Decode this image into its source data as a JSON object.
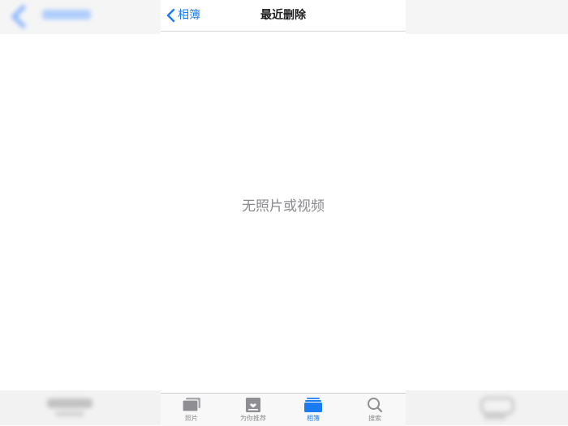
{
  "nav": {
    "back_label": "相簿",
    "title": "最近删除"
  },
  "main": {
    "empty_message": "无照片或视频"
  },
  "tabbar": {
    "tabs": [
      {
        "label": "照片",
        "icon": "photos-icon",
        "active": false
      },
      {
        "label": "为你推荐",
        "icon": "for-you-icon",
        "active": false
      },
      {
        "label": "相簿",
        "icon": "albums-icon",
        "active": true
      },
      {
        "label": "搜索",
        "icon": "search-icon",
        "active": false
      }
    ]
  },
  "colors": {
    "accent": "#1a7cf5",
    "inactive": "#8e8e93",
    "title": "#1c1c1e",
    "empty_text": "#8a8a8e"
  }
}
